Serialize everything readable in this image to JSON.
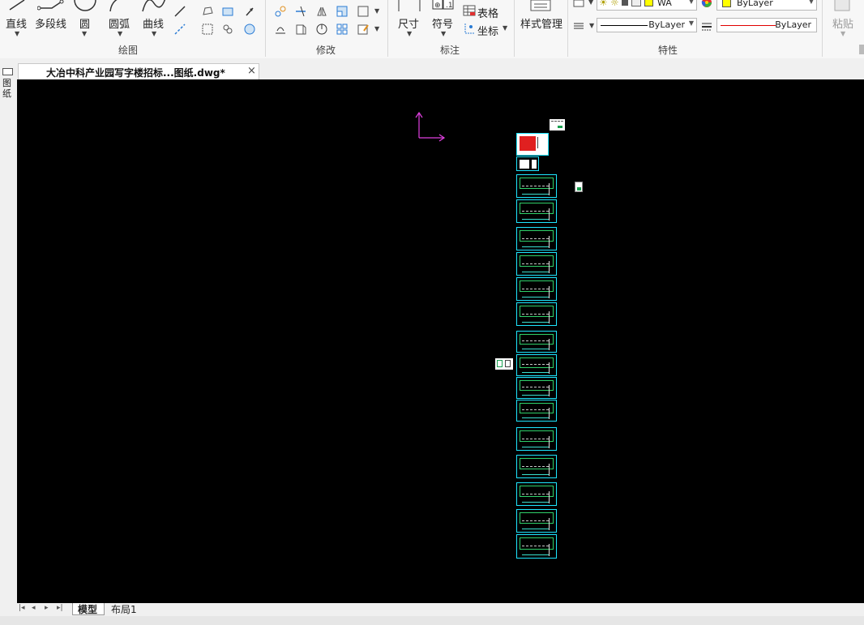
{
  "ribbon": {
    "draw": {
      "line": "直线",
      "polyline": "多段线",
      "circle": "圆",
      "arc": "圆弧",
      "curve": "曲线",
      "group_title": "绘图"
    },
    "modify": {
      "group_title": "修改"
    },
    "annotate": {
      "dimension": "尺寸",
      "symbol": "符号",
      "table": "表格",
      "coordinate": "坐标",
      "group_title": "标注"
    },
    "style_manager": {
      "label": "样式管理"
    },
    "properties": {
      "layer_name": "WA",
      "color_value": "ByLayer",
      "linetype_value": "ByLayer",
      "lineweight_value": "ByLayer",
      "group_title": "特性"
    },
    "clipboard": {
      "paste": "粘贴"
    }
  },
  "document": {
    "tab_title": "大冶中科产业园写字楼招标...图纸.dwg*",
    "close_glyph": "×"
  },
  "left_toolbar": {
    "vertical_text": "图纸"
  },
  "layout_tabs": {
    "model": "模型",
    "layout1": "布局1"
  },
  "colors": {
    "canvas": "#000000",
    "sheet_border": "#1ee6ff",
    "ucs_icon": "#e040e0",
    "layer_swatch": "#ffff00",
    "linetype_sample": "#e00000"
  },
  "icons": {
    "nav_first": "first-page-icon",
    "nav_prev": "prev-page-icon",
    "nav_next": "next-page-icon",
    "nav_last": "last-page-icon"
  }
}
